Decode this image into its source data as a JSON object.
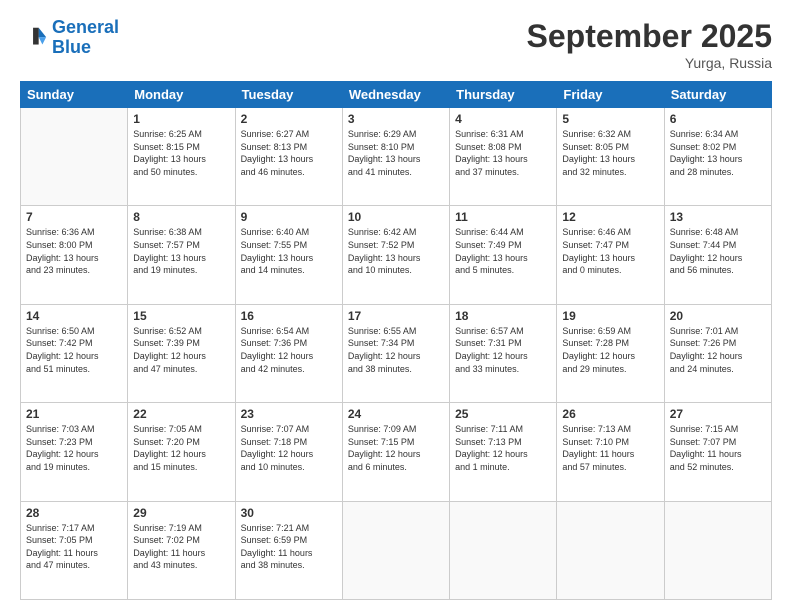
{
  "header": {
    "logo_line1": "General",
    "logo_line2": "Blue",
    "month_title": "September 2025",
    "location": "Yurga, Russia"
  },
  "weekdays": [
    "Sunday",
    "Monday",
    "Tuesday",
    "Wednesday",
    "Thursday",
    "Friday",
    "Saturday"
  ],
  "weeks": [
    [
      {
        "day": "",
        "info": ""
      },
      {
        "day": "1",
        "info": "Sunrise: 6:25 AM\nSunset: 8:15 PM\nDaylight: 13 hours\nand 50 minutes."
      },
      {
        "day": "2",
        "info": "Sunrise: 6:27 AM\nSunset: 8:13 PM\nDaylight: 13 hours\nand 46 minutes."
      },
      {
        "day": "3",
        "info": "Sunrise: 6:29 AM\nSunset: 8:10 PM\nDaylight: 13 hours\nand 41 minutes."
      },
      {
        "day": "4",
        "info": "Sunrise: 6:31 AM\nSunset: 8:08 PM\nDaylight: 13 hours\nand 37 minutes."
      },
      {
        "day": "5",
        "info": "Sunrise: 6:32 AM\nSunset: 8:05 PM\nDaylight: 13 hours\nand 32 minutes."
      },
      {
        "day": "6",
        "info": "Sunrise: 6:34 AM\nSunset: 8:02 PM\nDaylight: 13 hours\nand 28 minutes."
      }
    ],
    [
      {
        "day": "7",
        "info": "Sunrise: 6:36 AM\nSunset: 8:00 PM\nDaylight: 13 hours\nand 23 minutes."
      },
      {
        "day": "8",
        "info": "Sunrise: 6:38 AM\nSunset: 7:57 PM\nDaylight: 13 hours\nand 19 minutes."
      },
      {
        "day": "9",
        "info": "Sunrise: 6:40 AM\nSunset: 7:55 PM\nDaylight: 13 hours\nand 14 minutes."
      },
      {
        "day": "10",
        "info": "Sunrise: 6:42 AM\nSunset: 7:52 PM\nDaylight: 13 hours\nand 10 minutes."
      },
      {
        "day": "11",
        "info": "Sunrise: 6:44 AM\nSunset: 7:49 PM\nDaylight: 13 hours\nand 5 minutes."
      },
      {
        "day": "12",
        "info": "Sunrise: 6:46 AM\nSunset: 7:47 PM\nDaylight: 13 hours\nand 0 minutes."
      },
      {
        "day": "13",
        "info": "Sunrise: 6:48 AM\nSunset: 7:44 PM\nDaylight: 12 hours\nand 56 minutes."
      }
    ],
    [
      {
        "day": "14",
        "info": "Sunrise: 6:50 AM\nSunset: 7:42 PM\nDaylight: 12 hours\nand 51 minutes."
      },
      {
        "day": "15",
        "info": "Sunrise: 6:52 AM\nSunset: 7:39 PM\nDaylight: 12 hours\nand 47 minutes."
      },
      {
        "day": "16",
        "info": "Sunrise: 6:54 AM\nSunset: 7:36 PM\nDaylight: 12 hours\nand 42 minutes."
      },
      {
        "day": "17",
        "info": "Sunrise: 6:55 AM\nSunset: 7:34 PM\nDaylight: 12 hours\nand 38 minutes."
      },
      {
        "day": "18",
        "info": "Sunrise: 6:57 AM\nSunset: 7:31 PM\nDaylight: 12 hours\nand 33 minutes."
      },
      {
        "day": "19",
        "info": "Sunrise: 6:59 AM\nSunset: 7:28 PM\nDaylight: 12 hours\nand 29 minutes."
      },
      {
        "day": "20",
        "info": "Sunrise: 7:01 AM\nSunset: 7:26 PM\nDaylight: 12 hours\nand 24 minutes."
      }
    ],
    [
      {
        "day": "21",
        "info": "Sunrise: 7:03 AM\nSunset: 7:23 PM\nDaylight: 12 hours\nand 19 minutes."
      },
      {
        "day": "22",
        "info": "Sunrise: 7:05 AM\nSunset: 7:20 PM\nDaylight: 12 hours\nand 15 minutes."
      },
      {
        "day": "23",
        "info": "Sunrise: 7:07 AM\nSunset: 7:18 PM\nDaylight: 12 hours\nand 10 minutes."
      },
      {
        "day": "24",
        "info": "Sunrise: 7:09 AM\nSunset: 7:15 PM\nDaylight: 12 hours\nand 6 minutes."
      },
      {
        "day": "25",
        "info": "Sunrise: 7:11 AM\nSunset: 7:13 PM\nDaylight: 12 hours\nand 1 minute."
      },
      {
        "day": "26",
        "info": "Sunrise: 7:13 AM\nSunset: 7:10 PM\nDaylight: 11 hours\nand 57 minutes."
      },
      {
        "day": "27",
        "info": "Sunrise: 7:15 AM\nSunset: 7:07 PM\nDaylight: 11 hours\nand 52 minutes."
      }
    ],
    [
      {
        "day": "28",
        "info": "Sunrise: 7:17 AM\nSunset: 7:05 PM\nDaylight: 11 hours\nand 47 minutes."
      },
      {
        "day": "29",
        "info": "Sunrise: 7:19 AM\nSunset: 7:02 PM\nDaylight: 11 hours\nand 43 minutes."
      },
      {
        "day": "30",
        "info": "Sunrise: 7:21 AM\nSunset: 6:59 PM\nDaylight: 11 hours\nand 38 minutes."
      },
      {
        "day": "",
        "info": ""
      },
      {
        "day": "",
        "info": ""
      },
      {
        "day": "",
        "info": ""
      },
      {
        "day": "",
        "info": ""
      }
    ]
  ]
}
